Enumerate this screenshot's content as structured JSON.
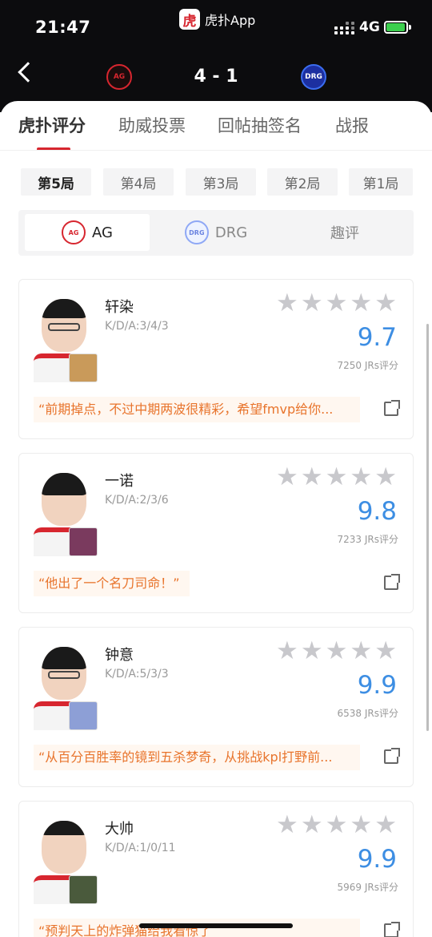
{
  "status": {
    "time": "21:47",
    "app_name": "虎扑App",
    "app_icon_glyph": "虎",
    "network": "4G"
  },
  "match": {
    "score": "4 - 1",
    "team_left": "AG",
    "team_right": "DRG"
  },
  "tabs": [
    {
      "label": "虎扑评分",
      "active": true
    },
    {
      "label": "助威投票",
      "active": false
    },
    {
      "label": "回帖抽签名",
      "active": false
    },
    {
      "label": "战报",
      "active": false
    }
  ],
  "games": [
    {
      "label": "第5局",
      "active": true
    },
    {
      "label": "第4局",
      "active": false
    },
    {
      "label": "第3局",
      "active": false
    },
    {
      "label": "第2局",
      "active": false
    },
    {
      "label": "第1局",
      "active": false
    }
  ],
  "team_tabs": [
    {
      "label": "AG",
      "active": true
    },
    {
      "label": "DRG",
      "active": false
    },
    {
      "label": "趣评",
      "active": false
    }
  ],
  "players": [
    {
      "name": "轩染",
      "kda": "K/D/A:3/4/3",
      "rating": "9.7",
      "votes": "7250 JRs评分",
      "comment": "“前期掉点，不过中期两波很精彩，希望fmvp给你...",
      "hero_color": "#c99a5a"
    },
    {
      "name": "一诺",
      "kda": "K/D/A:2/3/6",
      "rating": "9.8",
      "votes": "7233 JRs评分",
      "comment": "“他出了一个名刀司命！”",
      "hero_color": "#7a3a5e"
    },
    {
      "name": "钟意",
      "kda": "K/D/A:5/3/3",
      "rating": "9.9",
      "votes": "6538 JRs评分",
      "comment": "“从百分百胜率的镜到五杀梦奇，从挑战kpl打野前...",
      "hero_color": "#8d9fd6"
    },
    {
      "name": "大帅",
      "kda": "K/D/A:1/0/11",
      "rating": "9.9",
      "votes": "5969 JRs评分",
      "comment": "“预判天上的炸弹猫给我看惊了",
      "hero_color": "#4a5a3c"
    }
  ],
  "colors": {
    "accent": "#d7262f",
    "rating_blue": "#3d8ee3",
    "comment_orange": "#e8742c"
  }
}
